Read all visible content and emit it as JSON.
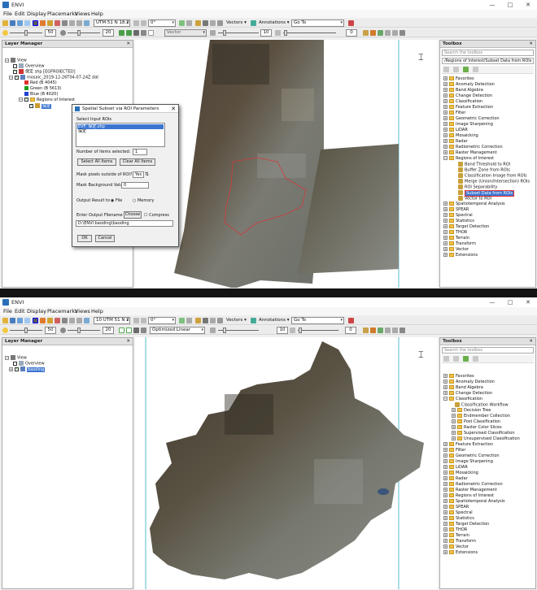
{
  "app_title": "ENVI",
  "menu": [
    "File",
    "Edit",
    "Display",
    "Placemarks",
    "Views",
    "Help"
  ],
  "window_controls": {
    "minimize": "—",
    "maximize": "□",
    "close": "✕"
  },
  "toolbar": {
    "top": {
      "projection": "UTM 51 N 18.2",
      "rotation": "0°",
      "vectors": "Vectors",
      "annotations": "Annotations",
      "goto": "Go To"
    },
    "bottom": {
      "projection": "10 UTM 51 N 2",
      "rotation": "0°",
      "vectors": "Vectors",
      "annotations": "Annotations",
      "goto": "Go To",
      "stretch": "Optimized Linear",
      "brightness": "50",
      "contrast": "20",
      "sharpen": "10",
      "transparency": "0"
    },
    "top_values": {
      "brightness": "50",
      "contrast": "20",
      "sharpen": "10",
      "transparency": "0",
      "stretch": "Vector"
    }
  },
  "top": {
    "layer_manager": {
      "title": "Layer Manager",
      "items": [
        {
          "label": "View"
        },
        {
          "label": "Overview"
        },
        {
          "label": "保定 shp [EGFROIECTED]"
        },
        {
          "label": "mosaic_2019-12-26T04-07-24Z dat"
        },
        {
          "label": "Red (B 4045)"
        },
        {
          "label": "Green (B 5613)"
        },
        {
          "label": "Blue (B 4020)"
        },
        {
          "label": "Regions of Interest"
        },
        {
          "label": "保定"
        }
      ]
    },
    "dialog": {
      "title": "Spatial Subset via ROI Parameters",
      "select_label": "Select Input ROIs",
      "roi_items": [
        "EVF: 保定.shp",
        "保定"
      ],
      "num_label": "Number of items selected:",
      "num_value": "1",
      "select_all": "Select All Items",
      "clear_all": "Clear All Items",
      "mask_outside_label": "Mask pixels outside of ROI?",
      "mask_outside_value": "Yes",
      "mask_bg_label": "Mask Background Value",
      "mask_bg_value": "0",
      "output_label": "Output Result to",
      "output_file": "File",
      "output_memory": "Memory",
      "filename_label": "Enter Output Filename",
      "choose": "Choose",
      "compress": "Compress",
      "filename_value": "D:\\ENVI baoding\\baoding",
      "ok": "OK",
      "cancel": "Cancel"
    },
    "toolbox": {
      "title": "Toolbox",
      "search_placeholder": "Search the toolbox",
      "path": "/Regions of Interest/Subset Data from ROIs",
      "items": [
        {
          "label": "Favorites"
        },
        {
          "label": "Anomaly Detection"
        },
        {
          "label": "Band Algebra"
        },
        {
          "label": "Change Detection"
        },
        {
          "label": "Classification"
        },
        {
          "label": "Feature Extraction"
        },
        {
          "label": "Filter"
        },
        {
          "label": "Geometric Correction"
        },
        {
          "label": "Image Sharpening"
        },
        {
          "label": "LiDAR"
        },
        {
          "label": "Mosaicking"
        },
        {
          "label": "Radar"
        },
        {
          "label": "Radiometric Correction"
        },
        {
          "label": "Raster Management"
        },
        {
          "label": "Regions of Interest"
        },
        {
          "label": "Band Threshold to ROI"
        },
        {
          "label": "Buffer Zone from ROIs"
        },
        {
          "label": "Classification Image from ROIs"
        },
        {
          "label": "Merge (Union/Intersection) ROIs"
        },
        {
          "label": "ROI Separability"
        },
        {
          "label": "Subset Data from ROIs"
        },
        {
          "label": "Vector to ROI"
        },
        {
          "label": "Spatiotemporal Analysis"
        },
        {
          "label": "SPEAR"
        },
        {
          "label": "Spectral"
        },
        {
          "label": "Statistics"
        },
        {
          "label": "Target Detection"
        },
        {
          "label": "THOR"
        },
        {
          "label": "Terrain"
        },
        {
          "label": "Transform"
        },
        {
          "label": "Vector"
        },
        {
          "label": "Extensions"
        }
      ]
    }
  },
  "bottom": {
    "layer_manager": {
      "title": "Layer Manager",
      "items": [
        {
          "label": "View"
        },
        {
          "label": "Overview"
        },
        {
          "label": "baoding"
        }
      ]
    },
    "toolbox": {
      "title": "Toolbox",
      "search_placeholder": "Search the toolbox",
      "items": [
        {
          "label": "Favorites"
        },
        {
          "label": "Anomaly Detection"
        },
        {
          "label": "Band Algebra"
        },
        {
          "label": "Change Detection"
        },
        {
          "label": "Classification"
        },
        {
          "label": "Classification Workflow"
        },
        {
          "label": "Decision Tree"
        },
        {
          "label": "Endmember Collection"
        },
        {
          "label": "Post Classification"
        },
        {
          "label": "Raster Color Slices"
        },
        {
          "label": "Supervised Classification"
        },
        {
          "label": "Unsupervised Classification"
        },
        {
          "label": "Feature Extraction"
        },
        {
          "label": "Filter"
        },
        {
          "label": "Geometric Correction"
        },
        {
          "label": "Image Sharpening"
        },
        {
          "label": "LiDAR"
        },
        {
          "label": "Mosaicking"
        },
        {
          "label": "Radar"
        },
        {
          "label": "Radiometric Correction"
        },
        {
          "label": "Raster Management"
        },
        {
          "label": "Regions of Interest"
        },
        {
          "label": "Spatiotemporal Analysis"
        },
        {
          "label": "SPEAR"
        },
        {
          "label": "Spectral"
        },
        {
          "label": "Statistics"
        },
        {
          "label": "Target Detection"
        },
        {
          "label": "THOR"
        },
        {
          "label": "Terrain"
        },
        {
          "label": "Transform"
        },
        {
          "label": "Vector"
        },
        {
          "label": "Extensions"
        }
      ]
    }
  }
}
